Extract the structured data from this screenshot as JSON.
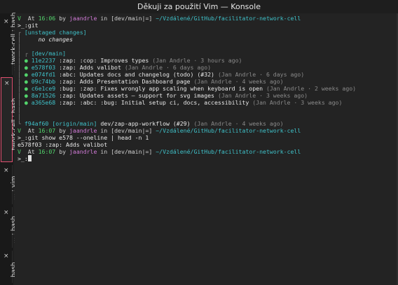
{
  "window": {
    "title": "Děkuji za použití Vim — Konsole"
  },
  "tabs": [
    {
      "label": "…twork-cell : bash",
      "close": "×",
      "active": false
    },
    {
      "label": "…twork-cell : bash",
      "close": "×",
      "active": true
    },
    {
      "label": "… : vim",
      "close": "×",
      "active": false
    },
    {
      "label": "… : bash",
      "close": "×",
      "active": false
    },
    {
      "label": "bash",
      "close": "×",
      "active": false
    }
  ],
  "terminal": {
    "prompt1": {
      "v": "V",
      "at": "At",
      "time": "16:06",
      "by": "by",
      "user": "jaandrle",
      "in": "in",
      "branch": "[dev/main|=]",
      "path": "~/Vzdálené/GitHub/facilitator-network-cell"
    },
    "cmd1": ">_:git",
    "unstaged_header": "[unstaged changes]",
    "no_changes": "no changes",
    "dev_main": "[dev/main]",
    "commits": [
      {
        "hash": "11e2237",
        "msg": ":zap: :cop: Improves types",
        "meta": "(Jan Andrle · 3 hours ago)"
      },
      {
        "hash": "e578f03",
        "msg": ":zap: Adds valibot",
        "meta": "(Jan Andrle · 6 days ago)"
      },
      {
        "hash": "e074fd1",
        "msg": ":abc: Updates docs and changelog (todo) (#32)",
        "meta": "(Jan Andrle · 6 days ago)"
      },
      {
        "hash": "09c74bb",
        "msg": ":zap: Adds Presentation Dashboard page",
        "meta": "(Jan Andrle · 4 weeks ago)"
      },
      {
        "hash": "c6e1ce9",
        "msg": ":bug: :zap: Fixes wrongly app scaling when keyboard is open",
        "meta": "(Jan Andrle · 2 weeks ago)"
      },
      {
        "hash": "8a71526",
        "msg": ":zap: Updates assets — support for svg images",
        "meta": "(Jan Andrle · 3 weeks ago)"
      },
      {
        "hash": "a365e68",
        "msg": ":zap: :abc: :bug: Initial setup ci, docs, accessibility",
        "meta": "(Jan Andrle · 3 weeks ago)"
      }
    ],
    "origin": {
      "hash": "f94af60",
      "ref": "[origin/main]",
      "msg": "dev/zap-app-workflow (#29)",
      "meta": "(Jan Andrle · 4 weeks ago)"
    },
    "prompt2": {
      "v": "V",
      "at": "At",
      "time": "16:07",
      "by": "by",
      "user": "jaandrle",
      "in": "in",
      "branch": "[dev/main|=]",
      "path": "~/Vzdálené/GitHub/facilitator-network-cell"
    },
    "cmd2": ">_:git show e578 --oneline | head -n 1",
    "output2": "e578f03 :zap: Adds valibot",
    "prompt3": {
      "v": "V",
      "at": "At",
      "time": "16:07",
      "by": "by",
      "user": "jaandrle",
      "in": "in",
      "branch": "[dev/main|=]",
      "path": "~/Vzdálené/GitHub/facilitator-network-cell"
    },
    "cmd3": ">_:"
  },
  "colors": {
    "prompt_green": "#52d36b",
    "user_magenta": "#d07ad6",
    "path_cyan": "#3fc0c8",
    "hash_cyan": "#3fc0c8",
    "active_tab_border": "#e05070"
  }
}
